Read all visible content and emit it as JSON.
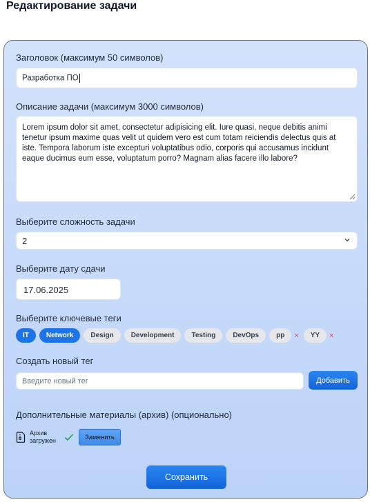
{
  "page_title": "Редактирование задачи",
  "form": {
    "title_label": "Заголовок (максимум 50 символов)",
    "title_value": "Разработка ПО",
    "description_label": "Описание задачи (максимум 3000 символов)",
    "description_value": "Lorem ipsum dolor sit amet, consectetur adipisicing elit. Iure quasi, neque debitis animi tenetur ipsum maxime quas velit ut quidem vero est cum totam reiciendis delectus quis at iste. Tempora laborum iste excepturi voluptatibus odio, corporis qui accusamus incidunt eaque ducimus eum esse, voluptatum porro? Magnam alias facere illo labore?",
    "difficulty_label": "Выберите сложность задачи",
    "difficulty_value": "2",
    "date_label": "Выберите дату сдачи",
    "date_value": "17.06.2025",
    "tags_label": "Выберите ключевые теги",
    "tags": [
      {
        "label": "IT",
        "selected": true,
        "removable": false
      },
      {
        "label": "Network",
        "selected": true,
        "removable": false
      },
      {
        "label": "Design",
        "selected": false,
        "removable": false
      },
      {
        "label": "Development",
        "selected": false,
        "removable": false
      },
      {
        "label": "Testing",
        "selected": false,
        "removable": false
      },
      {
        "label": "DevOps",
        "selected": false,
        "removable": false
      },
      {
        "label": "pp",
        "selected": false,
        "removable": true
      },
      {
        "label": "YY",
        "selected": false,
        "removable": true
      }
    ],
    "tag_remove_glyph": "×",
    "new_tag_label": "Создать новый тег",
    "new_tag_placeholder": "Введите новый тег",
    "add_button": "Добавить",
    "attachments_label": "Дополнительные материалы (архив) (опционально)",
    "file_status": "Архив загружен",
    "replace_button": "Заменить",
    "save_button": "Сохранить"
  },
  "icons": {
    "chevron": "chevron-down-icon",
    "file": "archive-file-icon",
    "check": "check-icon"
  },
  "colors": {
    "accent": "#1b74e8",
    "remove": "#e23b3b",
    "success": "#22a046"
  }
}
